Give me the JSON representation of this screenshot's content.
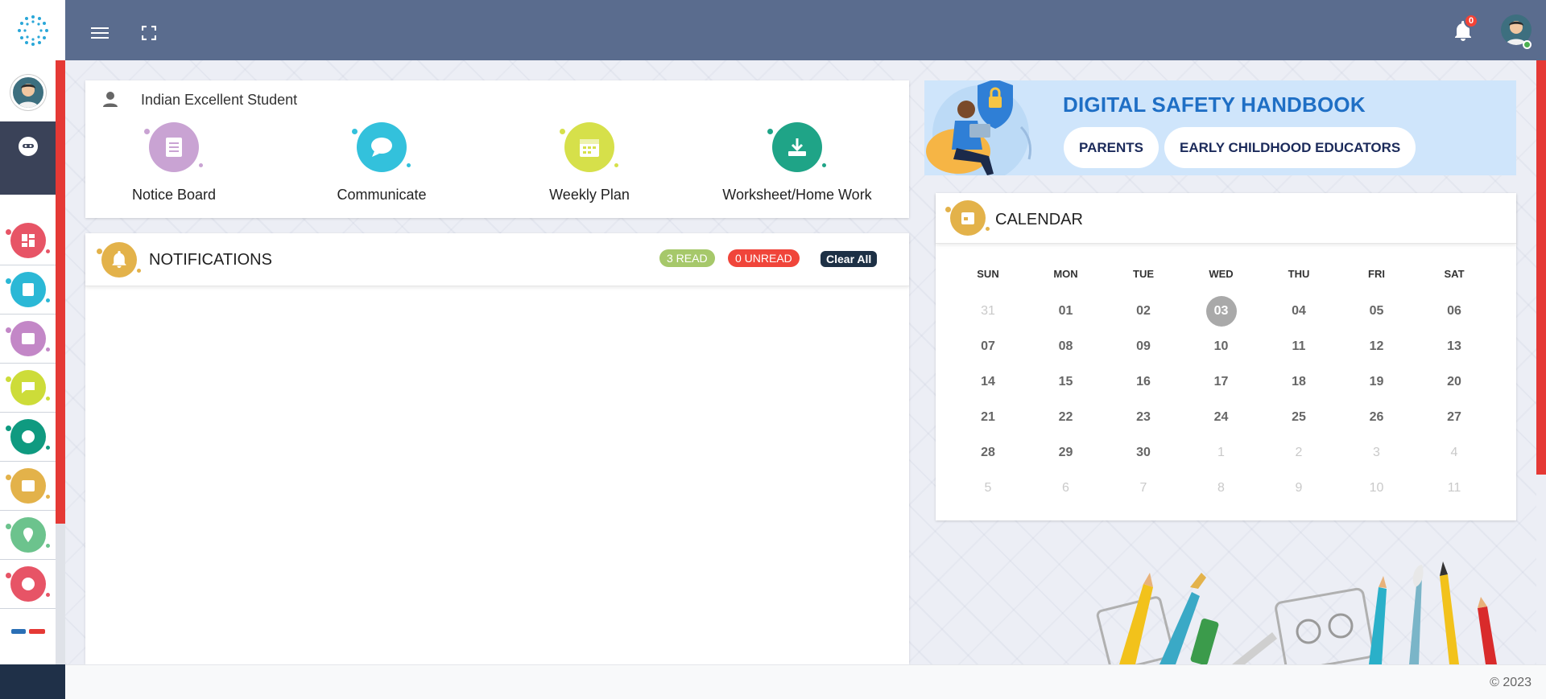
{
  "app": {
    "accent": "#5a6c8e",
    "sidebar_dark": "#3a4258"
  },
  "header": {
    "menu_icon": "hamburger-icon",
    "fullscreen_icon": "fullscreen-icon",
    "notification_count": "0"
  },
  "sidebar": {
    "items": [
      {
        "icon": "dashboard-icon",
        "color": "#e75466"
      },
      {
        "icon": "notice-icon",
        "color": "#2bb8d6"
      },
      {
        "icon": "gallery-icon",
        "color": "#c387c7"
      },
      {
        "icon": "chat-icon",
        "color": "#cddc39"
      },
      {
        "icon": "palette-icon",
        "color": "#0f9a80"
      },
      {
        "icon": "calendar-icon",
        "color": "#e3b24a"
      },
      {
        "icon": "location-icon",
        "color": "#6cc38d"
      },
      {
        "icon": "palette-icon",
        "color": "#e75466"
      }
    ]
  },
  "quick": {
    "student_name": "Indian Excellent Student",
    "items": [
      {
        "label": "Notice Board",
        "color": "#c9a3d3"
      },
      {
        "label": "Communicate",
        "color": "#33c1dc"
      },
      {
        "label": "Weekly Plan",
        "color": "#d6e04a"
      },
      {
        "label": "Worksheet/Home Work",
        "color": "#1fa487"
      }
    ]
  },
  "notifications": {
    "title": "NOTIFICATIONS",
    "read": "3 READ",
    "unread": "0 UNREAD",
    "clear": "Clear All"
  },
  "banner": {
    "title": "DIGITAL SAFETY HANDBOOK",
    "btn_parents": "PARENTS",
    "btn_educators": "EARLY CHILDHOOD EDUCATORS"
  },
  "calendar": {
    "title": "CALENDAR",
    "weekdays": [
      "SUN",
      "MON",
      "TUE",
      "WED",
      "THU",
      "FRI",
      "SAT"
    ],
    "weeks": [
      [
        [
          "31",
          1
        ],
        [
          "01",
          0
        ],
        [
          "02",
          0
        ],
        [
          "03",
          2
        ],
        [
          "04",
          0
        ],
        [
          "05",
          0
        ],
        [
          "06",
          0
        ]
      ],
      [
        [
          "07",
          0
        ],
        [
          "08",
          0
        ],
        [
          "09",
          0
        ],
        [
          "10",
          0
        ],
        [
          "11",
          0
        ],
        [
          "12",
          0
        ],
        [
          "13",
          0
        ]
      ],
      [
        [
          "14",
          0
        ],
        [
          "15",
          0
        ],
        [
          "16",
          0
        ],
        [
          "17",
          0
        ],
        [
          "18",
          0
        ],
        [
          "19",
          0
        ],
        [
          "20",
          0
        ]
      ],
      [
        [
          "21",
          0
        ],
        [
          "22",
          0
        ],
        [
          "23",
          0
        ],
        [
          "24",
          0
        ],
        [
          "25",
          0
        ],
        [
          "26",
          0
        ],
        [
          "27",
          0
        ]
      ],
      [
        [
          "28",
          0
        ],
        [
          "29",
          0
        ],
        [
          "30",
          0
        ],
        [
          "1",
          1
        ],
        [
          "2",
          1
        ],
        [
          "3",
          1
        ],
        [
          "4",
          1
        ]
      ],
      [
        [
          "5",
          1
        ],
        [
          "6",
          1
        ],
        [
          "7",
          1
        ],
        [
          "8",
          1
        ],
        [
          "9",
          1
        ],
        [
          "10",
          1
        ],
        [
          "11",
          1
        ]
      ]
    ]
  },
  "footer": {
    "copyright": "© 2023"
  }
}
